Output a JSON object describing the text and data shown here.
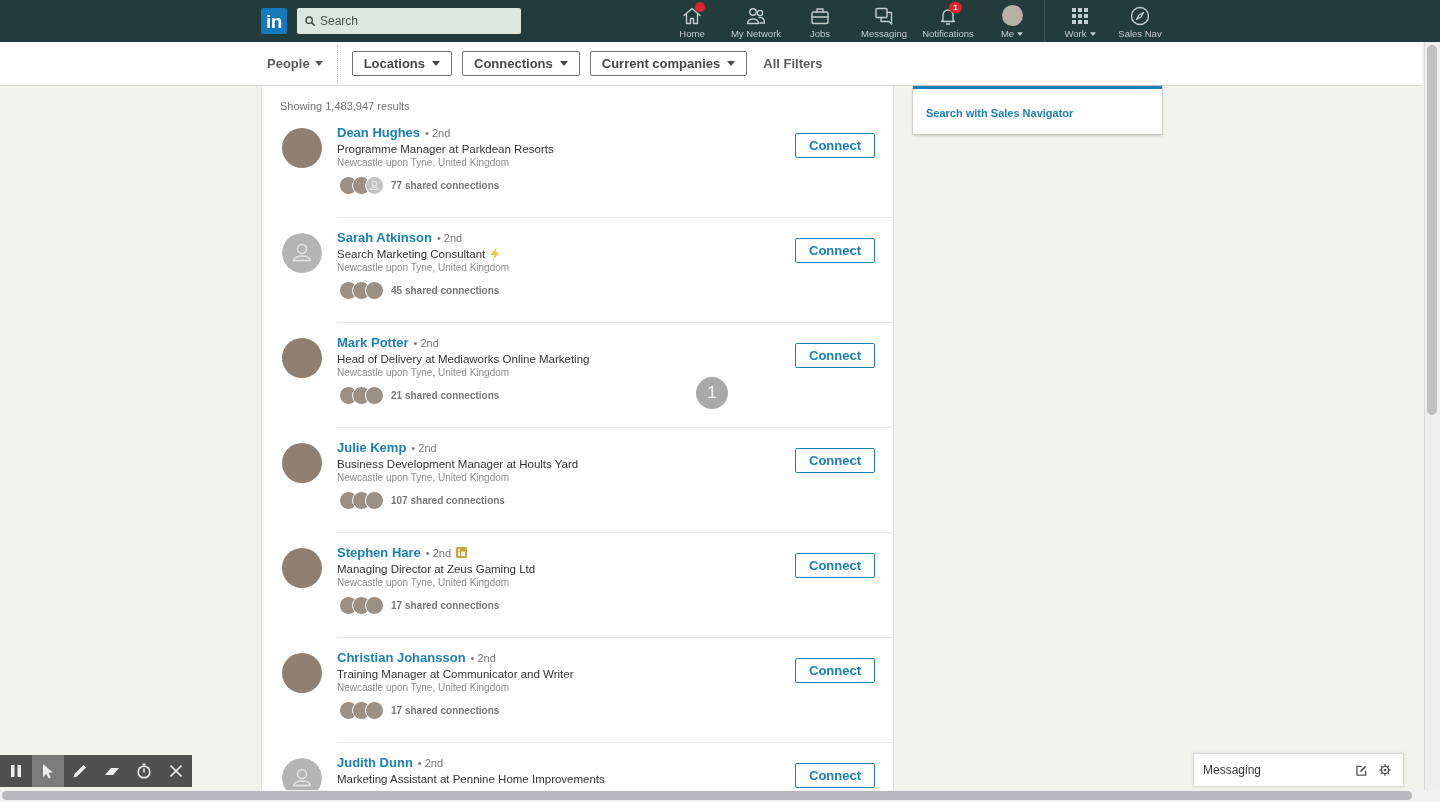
{
  "nav": {
    "logo": "in",
    "search": {
      "placeholder": "Search"
    },
    "items": [
      {
        "label": "Home",
        "kind": "icon",
        "dot": true,
        "dropdown": false,
        "selected": false
      },
      {
        "label": "My Network",
        "kind": "icon",
        "dot": false,
        "dropdown": false,
        "selected": false
      },
      {
        "label": "Jobs",
        "kind": "icon",
        "dot": false,
        "dropdown": false,
        "selected": false
      },
      {
        "label": "Messaging",
        "kind": "icon",
        "dot": false,
        "dropdown": false,
        "selected": false
      },
      {
        "label": "Notifications",
        "kind": "icon",
        "dot": false,
        "badge": "1",
        "dropdown": false,
        "selected": false
      },
      {
        "label": "Me",
        "kind": "avatar",
        "dot": false,
        "dropdown": true,
        "selected": false
      }
    ],
    "more_items": [
      {
        "label": "Work",
        "kind": "icon",
        "dropdown": true,
        "selected": false
      },
      {
        "label": "Sales Nav",
        "kind": "icon",
        "dropdown": false,
        "selected": false
      }
    ]
  },
  "filters": {
    "result_type": {
      "label": "People"
    },
    "buttons": [
      {
        "label": "Locations"
      },
      {
        "label": "Connections"
      },
      {
        "label": "Current companies"
      }
    ],
    "all_filters": {
      "label": "All Filters"
    }
  },
  "results": {
    "count": "Showing 1,483,947 results",
    "items": [
      {
        "name": "Dean Hughes",
        "degree": "• 2nd",
        "headline": "Programme Manager at Parkdean Resorts",
        "location": "Newcastle upon Tyne, United Kingdom",
        "shared": "77 shared connections",
        "shared_avatars": [
          {
            "kind": "photo"
          },
          {
            "kind": "photo"
          },
          {
            "kind": "ghost"
          }
        ],
        "has_photo": true,
        "headline_badge": false,
        "premium": false,
        "button": "Connect"
      },
      {
        "name": "Sarah Atkinson",
        "degree": "• 2nd",
        "headline": "Search Marketing Consultant",
        "location": "Newcastle upon Tyne, United Kingdom",
        "shared": "45 shared connections",
        "shared_avatars": [
          {
            "kind": "photo"
          },
          {
            "kind": "photo"
          },
          {
            "kind": "photo"
          }
        ],
        "has_photo": false,
        "headline_badge": true,
        "premium": false,
        "button": "Connect"
      },
      {
        "name": "Mark Potter",
        "degree": "• 2nd",
        "headline": "Head of Delivery at Mediaworks Online Marketing",
        "location": "Newcastle upon Tyne, United Kingdom",
        "shared": "21 shared connections",
        "shared_avatars": [
          {
            "kind": "photo"
          },
          {
            "kind": "photo"
          },
          {
            "kind": "photo"
          }
        ],
        "has_photo": true,
        "headline_badge": false,
        "premium": false,
        "button": "Connect"
      },
      {
        "name": "Julie Kemp",
        "degree": "• 2nd",
        "headline": "Business Development Manager at Hoults Yard",
        "location": "Newcastle upon Tyne, United Kingdom",
        "shared": "107 shared connections",
        "shared_avatars": [
          {
            "kind": "photo"
          },
          {
            "kind": "photo"
          },
          {
            "kind": "photo"
          }
        ],
        "has_photo": true,
        "headline_badge": false,
        "premium": false,
        "button": "Connect"
      },
      {
        "name": "Stephen Hare",
        "degree": "• 2nd",
        "headline": "Managing Director at Zeus Gaming Ltd",
        "location": "Newcastle upon Tyne, United Kingdom",
        "shared": "17 shared connections",
        "shared_avatars": [
          {
            "kind": "photo"
          },
          {
            "kind": "photo"
          },
          {
            "kind": "photo"
          }
        ],
        "has_photo": true,
        "headline_badge": false,
        "premium": true,
        "button": "Connect"
      },
      {
        "name": "Christian Johansson",
        "degree": "• 2nd",
        "headline": "Training Manager at Communicator and Writer",
        "location": "Newcastle upon Tyne, United Kingdom",
        "shared": "17 shared connections",
        "shared_avatars": [
          {
            "kind": "photo"
          },
          {
            "kind": "photo"
          },
          {
            "kind": "photo"
          }
        ],
        "has_photo": true,
        "headline_badge": false,
        "premium": false,
        "button": "Connect"
      },
      {
        "name": "Judith Dunn",
        "degree": "• 2nd",
        "headline": "Marketing Assistant at Pennine Home Improvements",
        "has_photo": false,
        "headline_badge": false,
        "premium": false,
        "button": "Connect"
      }
    ]
  },
  "sidebar": {
    "link": "Search with Sales Navigator"
  },
  "messaging": {
    "label": "Messaging"
  },
  "recorder_toolbar": {
    "tools": [
      {
        "selected": false
      },
      {
        "selected": true
      },
      {
        "selected": false
      },
      {
        "selected": false
      },
      {
        "selected": false
      },
      {
        "selected": false
      }
    ]
  },
  "click_marker": {
    "label": "1"
  }
}
